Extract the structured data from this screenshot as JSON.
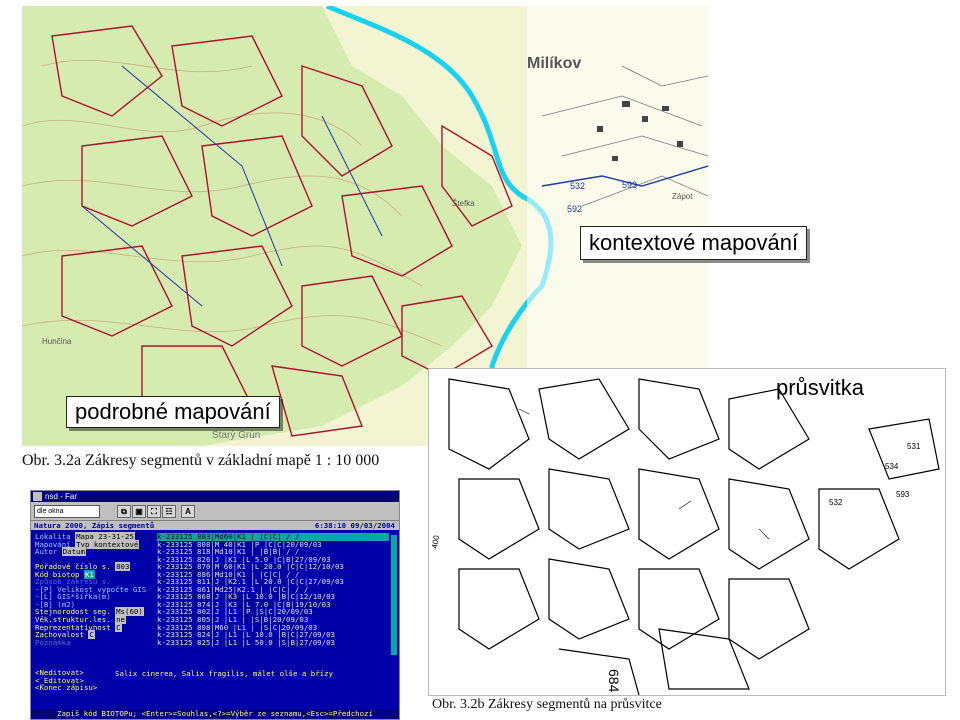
{
  "callouts": {
    "context": "kontextové mapování",
    "detailed": "podrobné mapování",
    "tracing": "průsvitka"
  },
  "captions": {
    "fig_a": "Obr. 3.2a Zákresy segmentů v základní mapě 1 : 10 000",
    "fig_b": "Obr. 3.2b Zákresy segmentů na průsvitce"
  },
  "map_top": {
    "place_name": "Milíkov",
    "labels": [
      "Štefka",
      "Zápot",
      "Hunčina",
      "Starý Grún",
      "532",
      "593",
      "592"
    ]
  },
  "map_bottom": {
    "labels": [
      "400",
      "684",
      "532",
      "593",
      "531",
      "534"
    ]
  },
  "colors": {
    "stream": "#19d2f0",
    "segments": "#b0102a",
    "map_bg": "#f3f5d2",
    "forest": "#c8e6a0",
    "dos_bg": "#0000a8"
  },
  "dos": {
    "window_title": "nsd - Far",
    "dropdown": "dle okna",
    "toolbar_a": "A",
    "status_left": "Natura 2000, Zápis segmentů",
    "status_right": "6:38:10  09/03/2004",
    "fields": [
      {
        "label": "Lokalita",
        "value": "Mapa  23-31-25"
      },
      {
        "label": "Mapování",
        "value": "Typ  kontextové"
      },
      {
        "label": "Autor",
        "value": "Datum"
      },
      {
        "label": "",
        "value": ""
      },
      {
        "label": "Pořadové číslo s.",
        "value": "803"
      },
      {
        "label": "Kód biotop",
        "value": "K1"
      },
      {
        "label": "Způsob zákresu s.",
        "value": ""
      },
      {
        "label": "-[P] Velikost vypočte GIS",
        "value": ""
      },
      {
        "label": "-[L] GIS*šířka(m)",
        "value": ""
      },
      {
        "label": "-[B] (m2)",
        "value": ""
      },
      {
        "label": "Stejnorodost seg.",
        "value": "Ms(60)"
      },
      {
        "label": "Věk.struktur.les.",
        "value": "ne"
      },
      {
        "label": "Reprezentativnost",
        "value": "C"
      },
      {
        "label": "Zachovalost",
        "value": "C"
      },
      {
        "label": "Poznámka",
        "value": ""
      }
    ],
    "records": [
      "k-233125 803|Md60|K1   |       |C|C| /  /",
      "k-233125 808|M 40|K1   |P      |C|C|20/09/03",
      "k-233125 818|Md10|K1   |       |B|B|  /  /",
      "k-233125 826|J   |K1   |L  5.0 |C|B|27/09/03",
      "k-233125 870|M 60|K1   |L 20.0 |C|C|12/10/03",
      "k-233125 886|Md10|K1   |       |C|C|  /  /",
      "k-233125 811|J   |K2.1 |L 20.0 |C|C|27/09/03",
      "k-233125 861|Md25|K2.1 |       |C|C|  /  /",
      "k-233125 868|J   |K3   |L 10.0 |B|C|12/10/03",
      "k-233125 874|J   |K3   |L  7.0 |C|B|19/10/03",
      "k-233125 802|J   |L1   |P      |S|C|20/09/03",
      "k-233125 805|J   |L1   |       |S|B|20/09/03",
      "k-233125 808|M60 |L1   |       |S|C|20/09/03",
      "k-233125 824|J   |L1   |L 10.0 |B|C|27/09/03",
      "k-233125 825|J   |L1   |L 50.0 |S|B|27/09/03"
    ],
    "menu": [
      "<Neditovat>",
      "<_Editovat>",
      "<Konec zápisu>"
    ],
    "note": "Salix cinerea, Salix fragilis, málet olše a břízy",
    "bottom_bar": "Zapiš kód BIOTOPu; <Enter>=Souhlas,<?>=Výběr ze seznamu,<Esc>=Předchozí"
  }
}
